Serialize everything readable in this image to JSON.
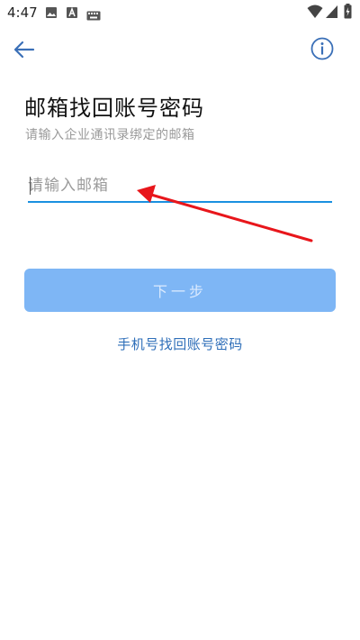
{
  "status_bar": {
    "time": "4:47",
    "icons": [
      "image-icon",
      "a-icon",
      "keyboard-icon",
      "wifi-icon",
      "signal-icon",
      "battery-icon"
    ]
  },
  "app_bar": {
    "back_icon": "arrow-left-icon",
    "info_icon": "info-circle-icon",
    "accent_color": "#3a6fb7"
  },
  "page": {
    "title": "邮箱找回账号密码",
    "subtitle": "请输入企业通讯录绑定的邮箱"
  },
  "email": {
    "placeholder": "请输入邮箱",
    "value": ""
  },
  "next_button": {
    "label": "下一步",
    "color": "#7eb6f5"
  },
  "phone_link": {
    "label": "手机号找回账号密码",
    "color": "#2f6fb9"
  },
  "annotation": {
    "color": "#e8161b"
  }
}
